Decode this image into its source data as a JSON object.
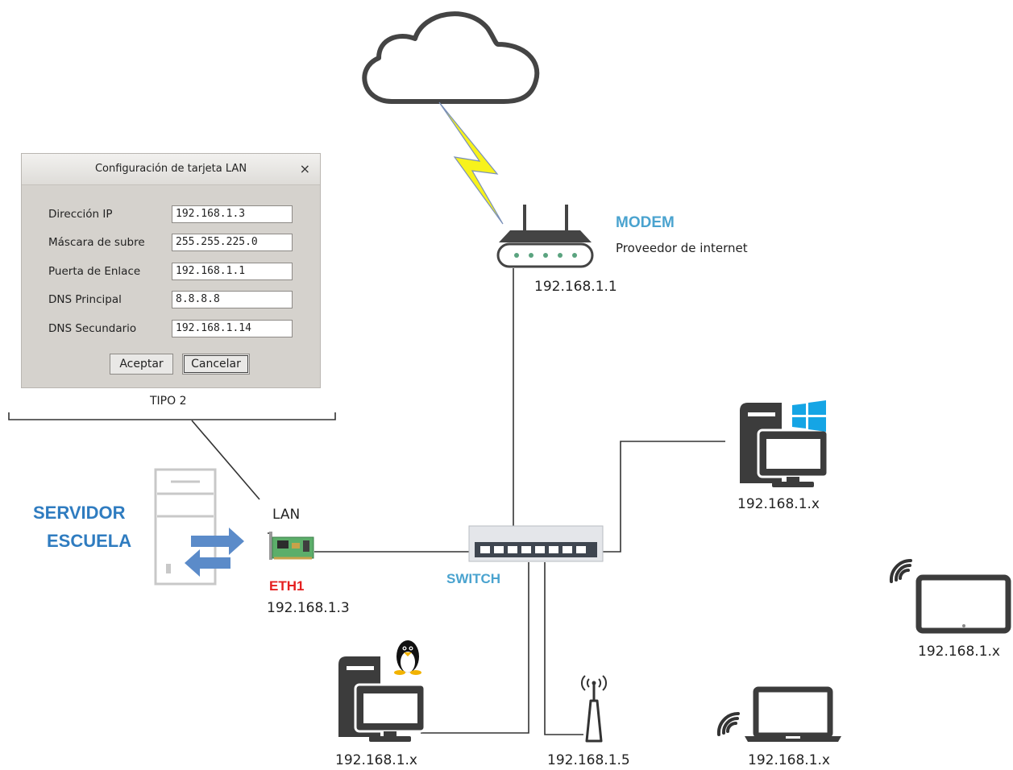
{
  "dialog": {
    "title": "Configuración de tarjeta LAN",
    "close_glyph": "×",
    "fields": [
      {
        "label": "Dirección IP",
        "value": "192.168.1.3"
      },
      {
        "label": "Máscara de subre",
        "value": "255.255.225.0"
      },
      {
        "label": "Puerta de Enlace",
        "value": "192.168.1.1"
      },
      {
        "label": "DNS Principal",
        "value": "8.8.8.8"
      },
      {
        "label": "DNS Secundario",
        "value": "192.168.1.14"
      }
    ],
    "accept_label": "Aceptar",
    "cancel_label": "Cancelar",
    "caption": "TIPO 2"
  },
  "modem": {
    "name": "MODEM",
    "subtitle": "Proveedor de internet",
    "ip": "192.168.1.1"
  },
  "server": {
    "name_line1": "SERVIDOR",
    "name_line2": "ESCUELA"
  },
  "nic": {
    "label": "LAN",
    "name": "ETH1",
    "ip": "192.168.1.3"
  },
  "switch": {
    "name": "SWITCH"
  },
  "windows_pc": {
    "ip": "192.168.1.x"
  },
  "tablet": {
    "ip": "192.168.1.x"
  },
  "linux_pc": {
    "ip": "192.168.1.x"
  },
  "access_point": {
    "ip": "192.168.1.5"
  },
  "laptop": {
    "ip": "192.168.1.x"
  },
  "icons": {
    "cloud": "cloud-icon",
    "lightning": "lightning-icon",
    "router": "router-icon",
    "server": "server-icon",
    "transfer": "transfer-arrows-icon",
    "nic": "network-card-icon",
    "switch": "switch-icon",
    "desktop": "desktop-computer-icon",
    "windows": "windows-logo-icon",
    "linux": "linux-tux-icon",
    "antenna": "access-point-icon",
    "tablet": "tablet-icon",
    "laptop": "laptop-icon",
    "wifi": "wifi-signal-icon"
  },
  "colors": {
    "accent_blue": "#2f7cc0",
    "light_blue": "#4aa3cf",
    "eth_red": "#e52020",
    "icon_gray": "#3c3c3c",
    "lightning_yellow": "#f7f21c"
  }
}
